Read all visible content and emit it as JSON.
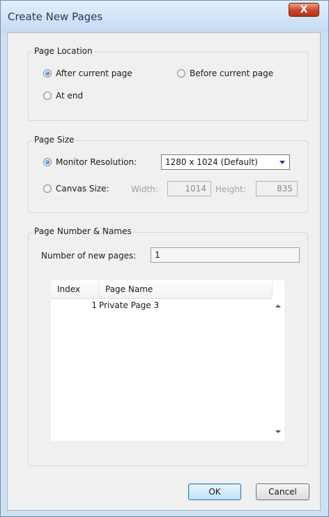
{
  "window": {
    "title": "Create New Pages",
    "close_glyph": "X"
  },
  "page_location": {
    "title": "Page Location",
    "options": [
      {
        "label": "After current page",
        "selected": true
      },
      {
        "label": "Before current page",
        "selected": false
      },
      {
        "label": "At end",
        "selected": false
      }
    ]
  },
  "page_size": {
    "title": "Page Size",
    "monitor_label": "Monitor Resolution:",
    "monitor_value": "1280 x 1024 (Default)",
    "canvas_label": "Canvas Size:",
    "width_label": "Width:",
    "width_value": "1014",
    "height_label": "Height:",
    "height_value": "835"
  },
  "page_names": {
    "title": "Page Number & Names",
    "count_label": "Number of new pages:",
    "count_value": "1",
    "columns": [
      "Index",
      "Page Name"
    ],
    "rows": [
      {
        "index": "1",
        "name": "Private Page 3"
      }
    ]
  },
  "buttons": {
    "ok": "OK",
    "cancel": "Cancel"
  },
  "colors": {
    "accent": "#1c5fb5",
    "close": "#c9452c"
  }
}
